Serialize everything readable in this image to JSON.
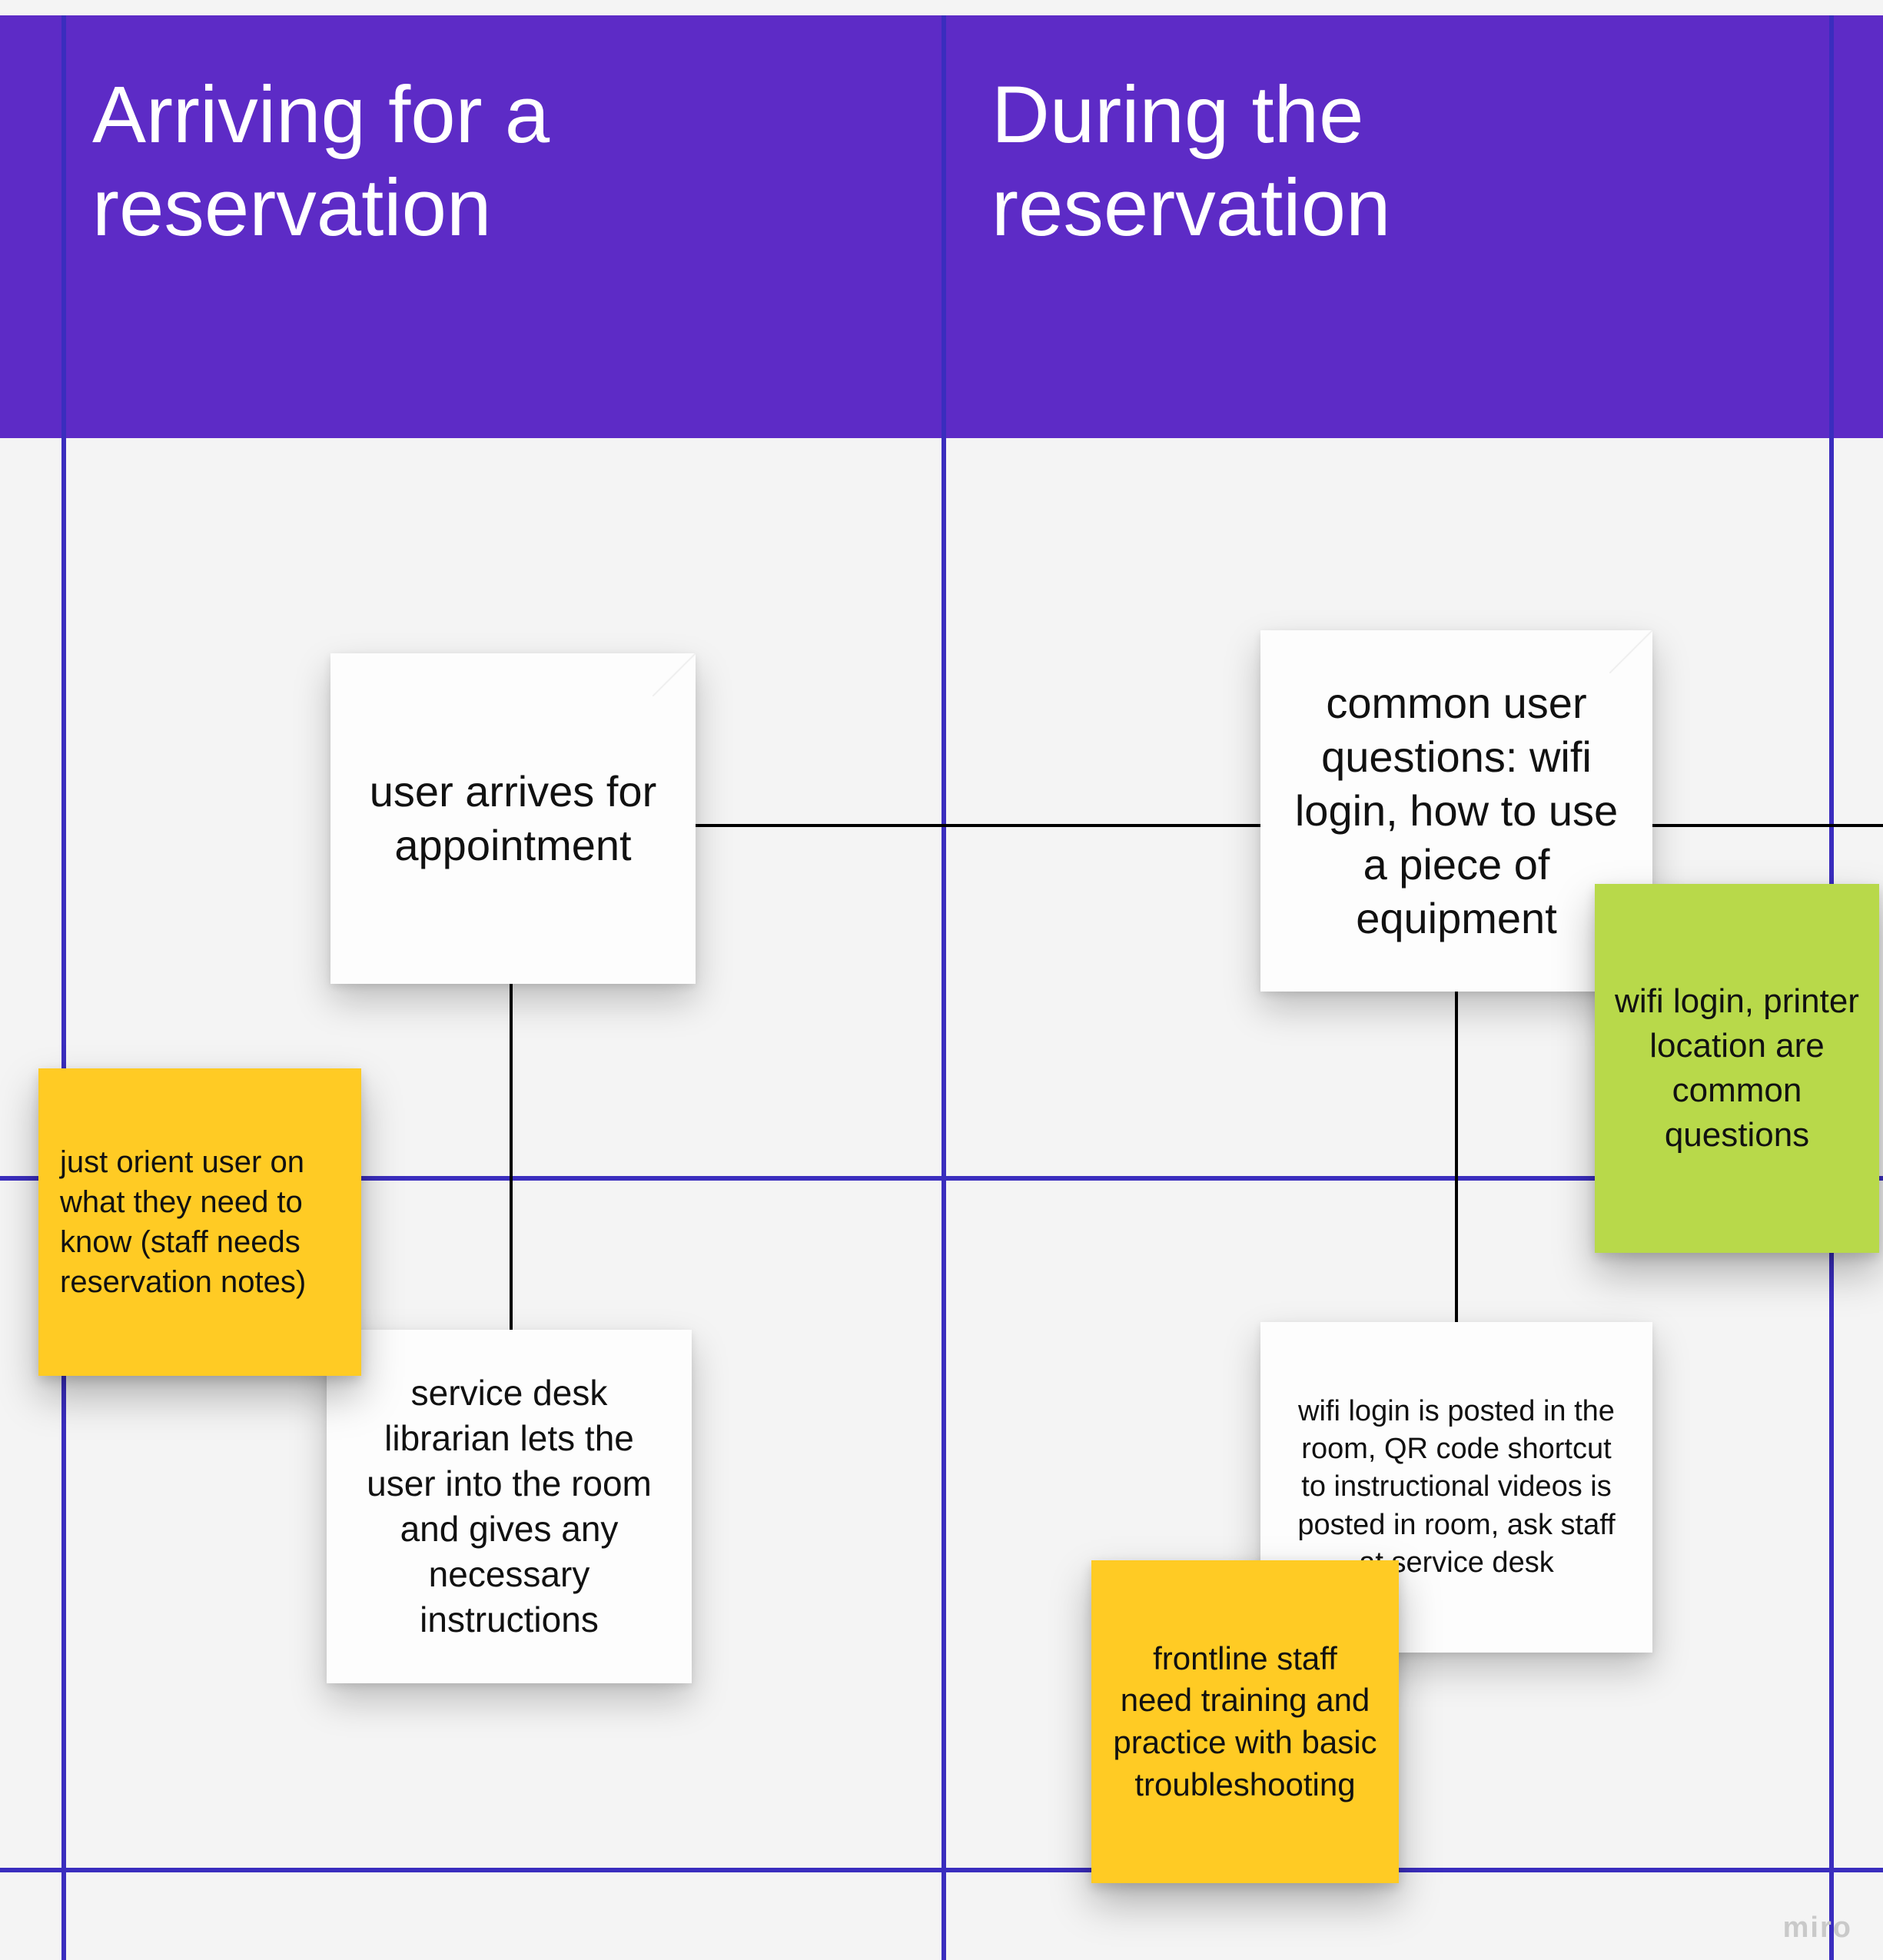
{
  "colors": {
    "header_purple": "#5D2BC6",
    "grid_blue": "#3A2DBE",
    "sticky_yellow": "#FFCB24",
    "sticky_green": "#B8D94A",
    "canvas_bg": "#f4f4f4"
  },
  "columns": [
    {
      "title": "Arriving for a reservation"
    },
    {
      "title": "During the reservation"
    }
  ],
  "cards": {
    "c1": {
      "text": "user arrives for appointment"
    },
    "c2": {
      "text": "common user questions:\nwifi login, how to use a piece of equipment"
    },
    "c3": {
      "text": "service desk librarian lets the user into the room and gives any necessary instructions"
    },
    "c4": {
      "text": "wifi login is posted in the room,\nQR code shortcut to instructional videos is posted in room,\nask staff at service desk"
    }
  },
  "stickies": {
    "s1": {
      "color": "yellow",
      "text": "just orient user on what they need to know (staff needs reservation notes)"
    },
    "s2": {
      "color": "green",
      "text": "wifi login, printer location are common questions"
    },
    "s3": {
      "color": "yellow",
      "text": "frontline staff need training and practice with basic troubleshooting"
    }
  },
  "watermark": "miro"
}
